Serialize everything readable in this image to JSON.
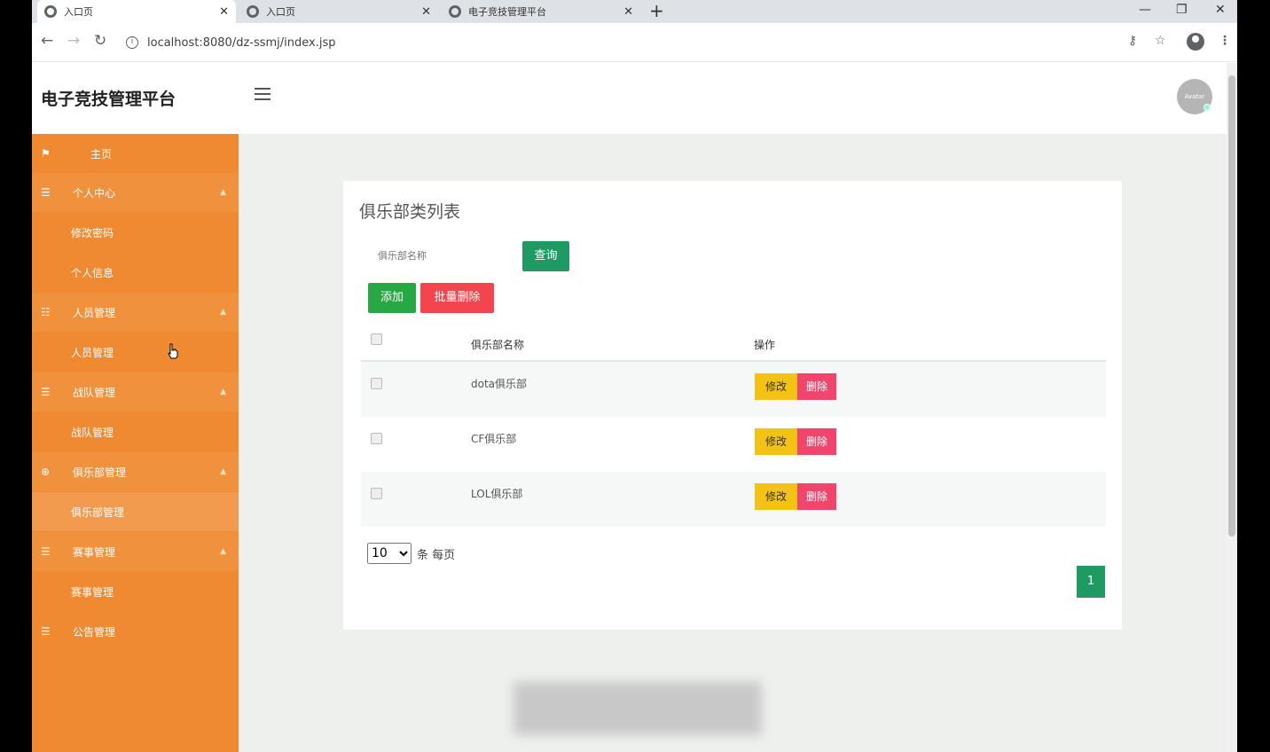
{
  "browser": {
    "tabs": [
      {
        "label": "入口页"
      },
      {
        "label": "入口页"
      },
      {
        "label": "电子竞技管理平台"
      }
    ],
    "new_tab": "+",
    "url": "localhost:8080/dz-ssmj/index.jsp"
  },
  "header": {
    "brand": "电子竞技管理平台",
    "avatar_text": "Avatar"
  },
  "sidebar": {
    "items": [
      {
        "label": "主页"
      },
      {
        "label": "个人中心"
      },
      {
        "label": "修改密码"
      },
      {
        "label": "个人信息"
      },
      {
        "label": "人员管理"
      },
      {
        "label": "人员管理"
      },
      {
        "label": "战队管理"
      },
      {
        "label": "战队管理"
      },
      {
        "label": "俱乐部管理"
      },
      {
        "label": "俱乐部管理"
      },
      {
        "label": "赛事管理"
      },
      {
        "label": "赛事管理"
      },
      {
        "label": "公告管理"
      }
    ]
  },
  "main": {
    "title": "俱乐部类列表",
    "search_placeholder": "俱乐部名称",
    "query_label": "查询",
    "add_label": "添加",
    "batch_delete_label": "批量删除",
    "columns": {
      "name": "俱乐部名称",
      "op": "操作"
    },
    "rows": [
      {
        "name": "dota俱乐部"
      },
      {
        "name": "CF俱乐部"
      },
      {
        "name": "LOL俱乐部"
      }
    ],
    "edit_label": "修改",
    "delete_label": "删除",
    "page_size": "10",
    "page_size_suffix": "条 每页",
    "current_page": "1"
  }
}
